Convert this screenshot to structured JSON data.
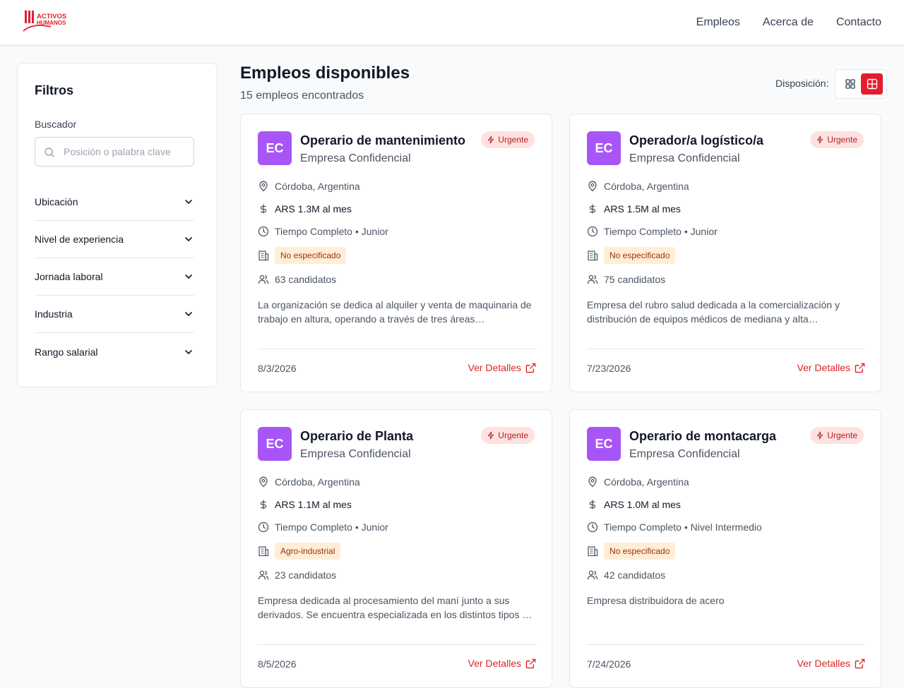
{
  "header": {
    "logo_line1": "ACTIVOS",
    "logo_line2": "HUMANOS",
    "nav": [
      "Empleos",
      "Acerca de",
      "Contacto"
    ]
  },
  "sidebar": {
    "title": "Filtros",
    "search_label": "Buscador",
    "search_placeholder": "Posición o palabra clave",
    "search_value": "",
    "filters": [
      "Ubicación",
      "Nivel de experiencia",
      "Jornada laboral",
      "Industria",
      "Rango salarial"
    ]
  },
  "main": {
    "title": "Empleos disponibles",
    "count": "15 empleos encontrados",
    "layout_label": "Disposición:"
  },
  "colors": {
    "brand": "#e21e2d",
    "avatar": "#a855f7",
    "urgent_bg": "#fee2e2",
    "urgent_text": "#b91c1c",
    "industry_bg": "#ffedd5",
    "link": "#dc2626"
  },
  "cards": [
    {
      "initials": "EC",
      "title": "Operario de mantenimiento",
      "company": "Empresa Confidencial",
      "badge": "Urgente",
      "location": "Córdoba, Argentina",
      "salary": "ARS 1.3M al mes",
      "schedule": "Tiempo Completo • Junior",
      "industry": "No especificado",
      "candidates": "63 candidatos",
      "description_l1": "La organización se dedica al alquiler y venta de maquinaria de",
      "description_l2": "trabajo en altura, operando a través de tres áreas…",
      "date": "8/3/2026",
      "details_label": "Ver Detalles"
    },
    {
      "initials": "EC",
      "title": "Operador/a logístico/a",
      "company": "Empresa Confidencial",
      "badge": "Urgente",
      "location": "Córdoba, Argentina",
      "salary": "ARS 1.5M al mes",
      "schedule": "Tiempo Completo • Junior",
      "industry": "No especificado",
      "candidates": "75 candidatos",
      "description_l1": "Empresa del rubro salud dedicada a la comercialización y",
      "description_l2": "distribución de equipos médicos de mediana y alta…",
      "date": "7/23/2026",
      "details_label": "Ver Detalles"
    },
    {
      "initials": "EC",
      "title": "Operario de Planta",
      "company": "Empresa Confidencial",
      "badge": "Urgente",
      "location": "Córdoba, Argentina",
      "salary": "ARS 1.1M al mes",
      "schedule": "Tiempo Completo • Junior",
      "industry": "Agro-industrial",
      "candidates": "23 candidatos",
      "description_l1": "Empresa dedicada al procesamiento del maní junto a sus",
      "description_l2": "derivados. Se encuentra especializada en los distintos tipos …",
      "date": "8/5/2026",
      "details_label": "Ver Detalles"
    },
    {
      "initials": "EC",
      "title": "Operario de montacarga",
      "company": "Empresa Confidencial",
      "badge": "Urgente",
      "location": "Córdoba, Argentina",
      "salary": "ARS 1.0M al mes",
      "schedule": "Tiempo Completo • Nivel Intermedio",
      "industry": "No especificado",
      "candidates": "42 candidatos",
      "description_l1": "Empresa distribuidora de acero",
      "description_l2": "",
      "date": "7/24/2026",
      "details_label": "Ver Detalles"
    }
  ]
}
